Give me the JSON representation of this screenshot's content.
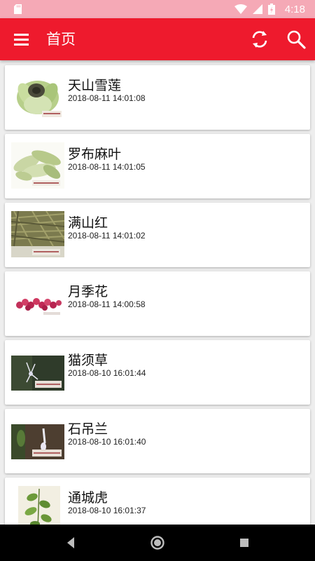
{
  "status_bar": {
    "time": "4:18"
  },
  "app_bar": {
    "title": "首页"
  },
  "items": [
    {
      "name": "天山雪莲",
      "date": "2018-08-11 14:01:08"
    },
    {
      "name": "罗布麻叶",
      "date": "2018-08-11 14:01:05"
    },
    {
      "name": "满山红",
      "date": "2018-08-11 14:01:02"
    },
    {
      "name": "月季花",
      "date": "2018-08-11 14:00:58"
    },
    {
      "name": "猫须草",
      "date": "2018-08-10 16:01:44"
    },
    {
      "name": "石吊兰",
      "date": "2018-08-10 16:01:40"
    },
    {
      "name": "通城虎",
      "date": "2018-08-10 16:01:37"
    }
  ],
  "colors": {
    "app_bar": "#ee1a2d",
    "status_bar": "#f5a9b6"
  }
}
